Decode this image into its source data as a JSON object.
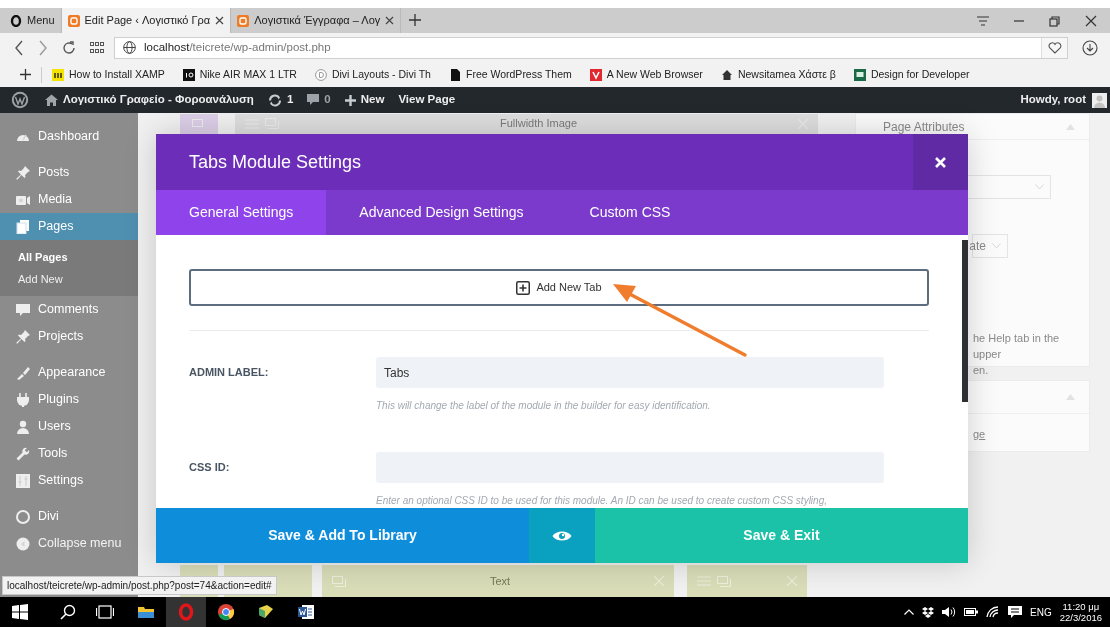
{
  "browser": {
    "tabs": [
      {
        "kind": "menu",
        "label": "Menu",
        "selected": false
      },
      {
        "kind": "page",
        "label": "Edit Page ‹ Λογιστικό Γρα",
        "selected": true
      },
      {
        "kind": "page",
        "label": "Λογιστικά Έγγραφα – Λογ",
        "selected": false
      }
    ],
    "address": {
      "host": "localhost",
      "path": "/teicrete/wp-admin/post.php"
    },
    "bookmarks": [
      "How to Install XAMP",
      "Nike AIR MAX 1 LTR",
      "Divi Layouts - Divi Th",
      "Free WordPress Them",
      "A New Web Browser",
      "Newsitamea Χάστε β",
      "Design for Developer"
    ]
  },
  "admin_bar": {
    "site": "Λογιστικό Γραφείο - Φοροανάλυση",
    "updates": "1",
    "comments": "0",
    "new": "New",
    "view": "View Page",
    "greeting": "Howdy, root"
  },
  "sidebar": {
    "groups": [
      [
        {
          "label": "Dashboard",
          "selected": false
        }
      ],
      [
        {
          "label": "Posts",
          "selected": false
        },
        {
          "label": "Media",
          "selected": false
        },
        {
          "label": "Pages",
          "selected": true,
          "children": [
            {
              "label": "All Pages",
              "selected": true
            },
            {
              "label": "Add New",
              "selected": false
            }
          ]
        },
        {
          "label": "Comments",
          "selected": false
        },
        {
          "label": "Projects",
          "selected": false
        }
      ],
      [
        {
          "label": "Appearance",
          "selected": false
        },
        {
          "label": "Plugins",
          "selected": false
        },
        {
          "label": "Users",
          "selected": false
        },
        {
          "label": "Tools",
          "selected": false
        },
        {
          "label": "Settings",
          "selected": false
        }
      ],
      [
        {
          "label": "Divi",
          "selected": false
        }
      ]
    ],
    "collapse": "Collapse menu"
  },
  "builder": {
    "top_module": "Fullwidth Image",
    "bottom_module": "Text"
  },
  "side_panel": {
    "title": "Page Attributes",
    "template_fragment": "ate",
    "help_lines": [
      "he Help tab in the upper",
      "en."
    ],
    "link_fragment": "ge"
  },
  "modal": {
    "title": "Tabs Module Settings",
    "tabs": [
      {
        "label": "General Settings",
        "selected": true
      },
      {
        "label": "Advanced Design Settings",
        "selected": false
      },
      {
        "label": "Custom CSS",
        "selected": false
      }
    ],
    "add_button": "Add New Tab",
    "fields": [
      {
        "label": "ADMIN LABEL:",
        "value": "Tabs",
        "description": "This will change the label of the module in the builder for easy identification."
      },
      {
        "label": "CSS ID:",
        "description": "Enter an optional CSS ID to be used for this module. An ID can be used to create custom CSS styling,"
      }
    ],
    "footer": {
      "library": "Save & Add To Library",
      "exit": "Save & Exit"
    }
  },
  "status_url": "localhost/teicrete/wp-admin/post.php?post=74&action=edit#",
  "taskbar": {
    "apps": [
      {
        "active": false
      },
      {
        "active": true
      },
      {
        "active": false
      },
      {
        "active": false
      },
      {
        "active": false
      }
    ],
    "language": "ENG",
    "time": "11:20 μμ",
    "date": "22/3/2016"
  }
}
